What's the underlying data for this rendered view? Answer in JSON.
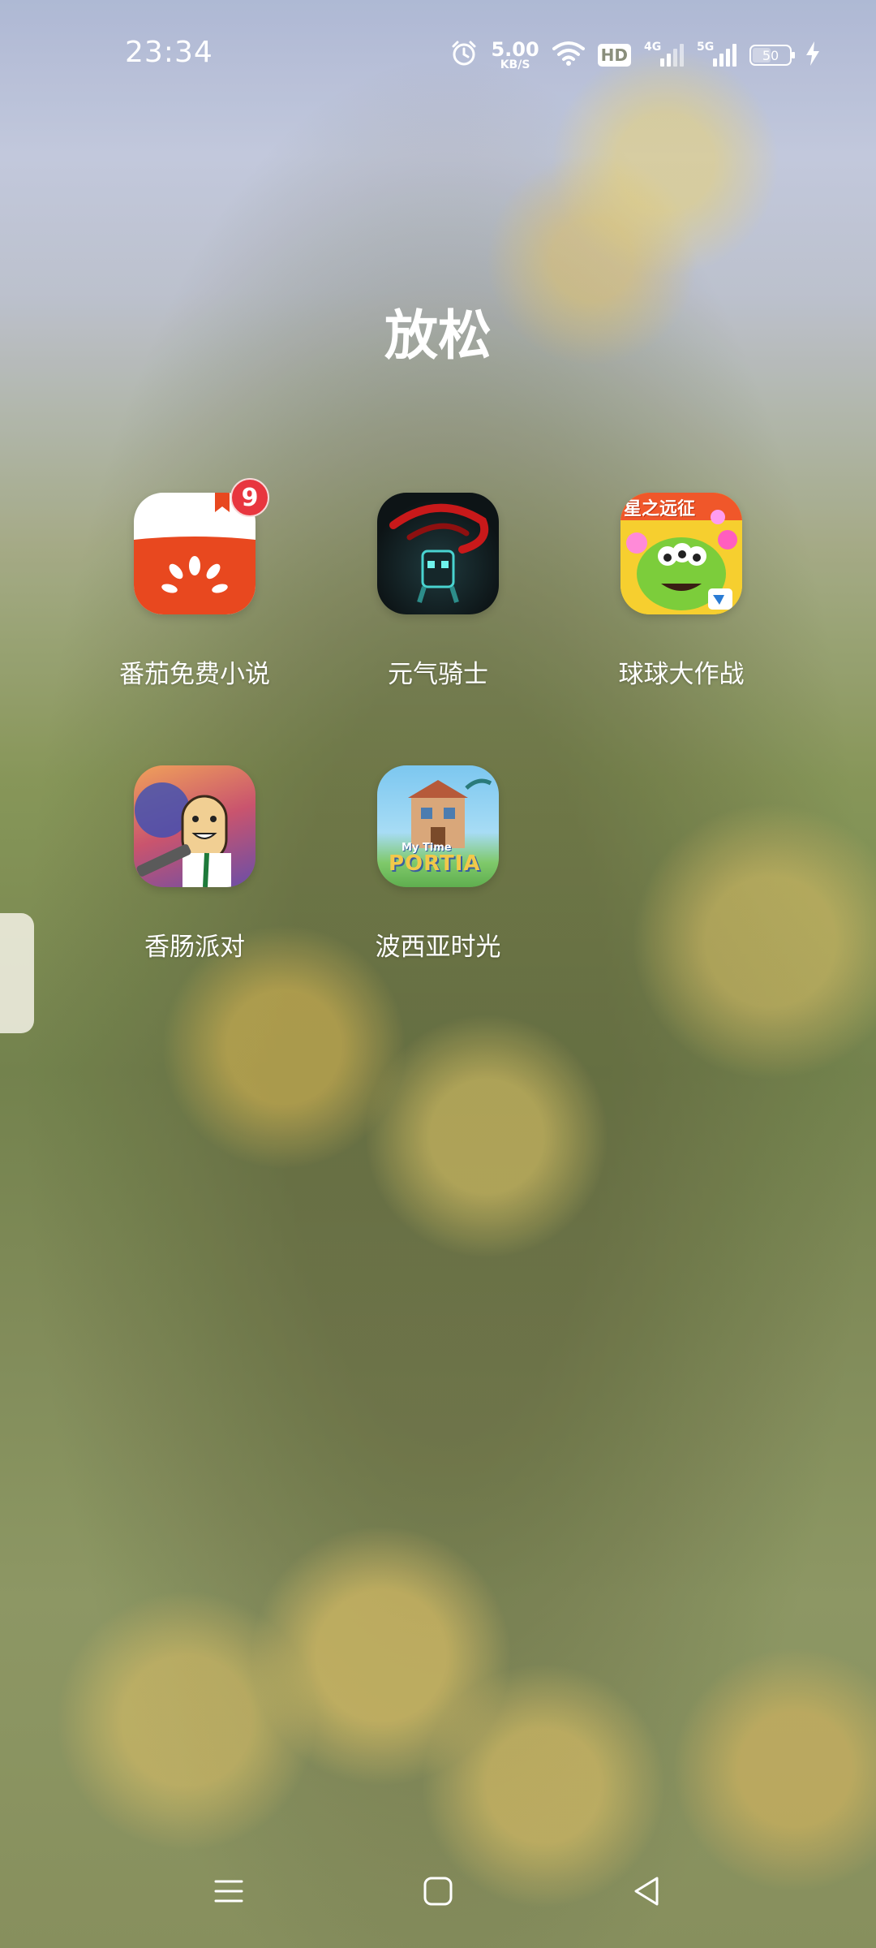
{
  "status_bar": {
    "time": "23:34",
    "net_speed_value": "5.00",
    "net_speed_unit": "KB/S",
    "hd_label": "HD",
    "sim1_label": "4G",
    "sim2_label": "5G",
    "battery_percent": 50,
    "battery_text": "50",
    "charging": true
  },
  "folder": {
    "title": "放松",
    "apps": [
      {
        "label": "番茄免费小说",
        "badge": "9",
        "icon": "tomato-novel-icon"
      },
      {
        "label": "元气骑士",
        "icon": "soul-knight-icon"
      },
      {
        "label": "球球大作战",
        "icon": "ball-battle-icon",
        "icon_text": "星之远征"
      },
      {
        "label": "香肠派对",
        "icon": "sausage-party-icon"
      },
      {
        "label": "波西亚时光",
        "icon": "my-time-at-portia-icon",
        "icon_text_top": "My Time",
        "icon_text_main": "PORTIA"
      }
    ]
  },
  "colors": {
    "tomato_red": "#e8481f",
    "badge_red": "#e8363f"
  }
}
